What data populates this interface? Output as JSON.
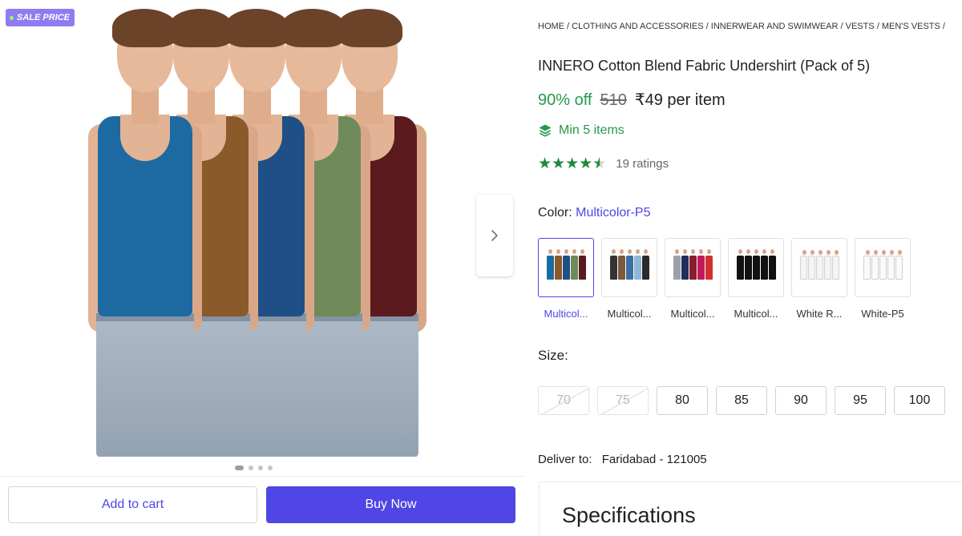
{
  "gallery": {
    "sale_badge": "SALE PRICE",
    "slide_count": 4,
    "active_slide": 1,
    "vest_colors": [
      "#1d6aa3",
      "#8a5a2a",
      "#1f4f86",
      "#6f8a5a",
      "#5b1a1e"
    ]
  },
  "actions": {
    "add_to_cart": "Add to cart",
    "buy_now": "Buy Now"
  },
  "product": {
    "breadcrumb": "HOME / CLOTHING AND ACCESSORIES / INNERWEAR AND SWIMWEAR / VESTS / MEN'S VESTS /",
    "title": "INNERO Cotton Blend Fabric Undershirt (Pack of 5)",
    "discount": "90% off",
    "mrp": "510",
    "price": "₹49 per item",
    "min_items": "Min 5 items",
    "rating": 4.5,
    "ratings_count": "19 ratings"
  },
  "color": {
    "label": "Color:",
    "selected": "Multicolor-P5",
    "options": [
      {
        "name": "Multicol...",
        "selected": true
      },
      {
        "name": "Multicol...",
        "selected": false
      },
      {
        "name": "Multicol...",
        "selected": false
      },
      {
        "name": "Multicol...",
        "selected": false
      },
      {
        "name": "White R...",
        "selected": false
      },
      {
        "name": "White-P5",
        "selected": false
      }
    ]
  },
  "size": {
    "label": "Size:",
    "options": [
      {
        "value": "70",
        "available": false
      },
      {
        "value": "75",
        "available": false
      },
      {
        "value": "80",
        "available": true
      },
      {
        "value": "85",
        "available": true
      },
      {
        "value": "90",
        "available": true
      },
      {
        "value": "95",
        "available": true
      },
      {
        "value": "100",
        "available": true
      }
    ]
  },
  "delivery": {
    "label": "Deliver to:",
    "location": "Faridabad - 121005"
  },
  "specifications": {
    "title": "Specifications"
  },
  "icons": {
    "next": "chevron-right-icon",
    "min_items": "layers-icon",
    "rating": "star-icon"
  },
  "colors": {
    "accent": "#5046e5",
    "discount_green": "#239a4a",
    "star_green": "#1f8a3b",
    "badge_purple": "#8f7cf2"
  }
}
